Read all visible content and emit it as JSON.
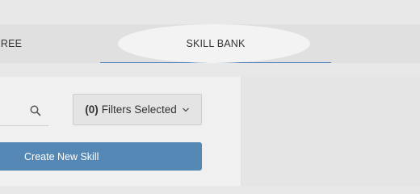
{
  "tabs": [
    {
      "label": "REE"
    },
    {
      "label": "SKILL BANK",
      "active": true
    }
  ],
  "search": {
    "placeholder": ""
  },
  "filters": {
    "count": "(0)",
    "label": "Filters Selected"
  },
  "create_button": {
    "label": "Create New Skill"
  },
  "icons": {
    "search": "search-icon",
    "chevron": "chevron-down-icon"
  },
  "colors": {
    "accent": "#5588b5",
    "tab_underline": "#4a7fb5"
  }
}
